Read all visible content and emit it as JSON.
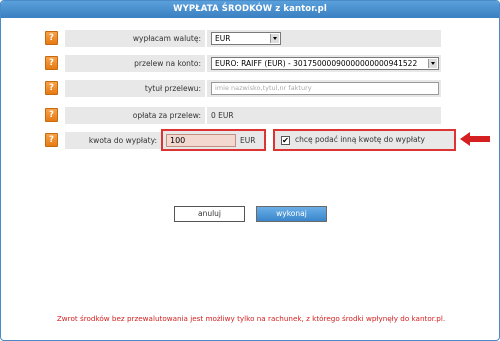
{
  "title": "WYPŁATA ŚRODKÓW z kantor.pl",
  "help_label": "?",
  "rows": {
    "currency": {
      "label": "wypłacam walutę:",
      "value": "EUR"
    },
    "transfer": {
      "label": "przelew na konto:",
      "value": "EURO: RAIFF (EUR) - 30175000090000000000941522"
    },
    "title_field": {
      "label": "tytuł przelewu:",
      "placeholder": "imie nazwisko,tytul,nr faktury"
    },
    "fee": {
      "label": "opłata za przelew:",
      "value": "0 EUR"
    },
    "amount": {
      "label": "kwota do wypłaty:",
      "value": "100",
      "unit": "EUR"
    }
  },
  "checkbox": {
    "mark": "✔",
    "label": "chcę podać inną kwotę do wypłaty"
  },
  "buttons": {
    "cancel": "anuluj",
    "submit": "wykonaj"
  },
  "footer": "Zwrot środków bez przewalutowania jest możliwy tylko na rachunek, z którego środki wpłynęły do kantor.pl.",
  "colors": {
    "accent": "#3a7fc0",
    "help": "#e57a14",
    "highlight": "#dd3333",
    "footer_text": "#d42020"
  }
}
